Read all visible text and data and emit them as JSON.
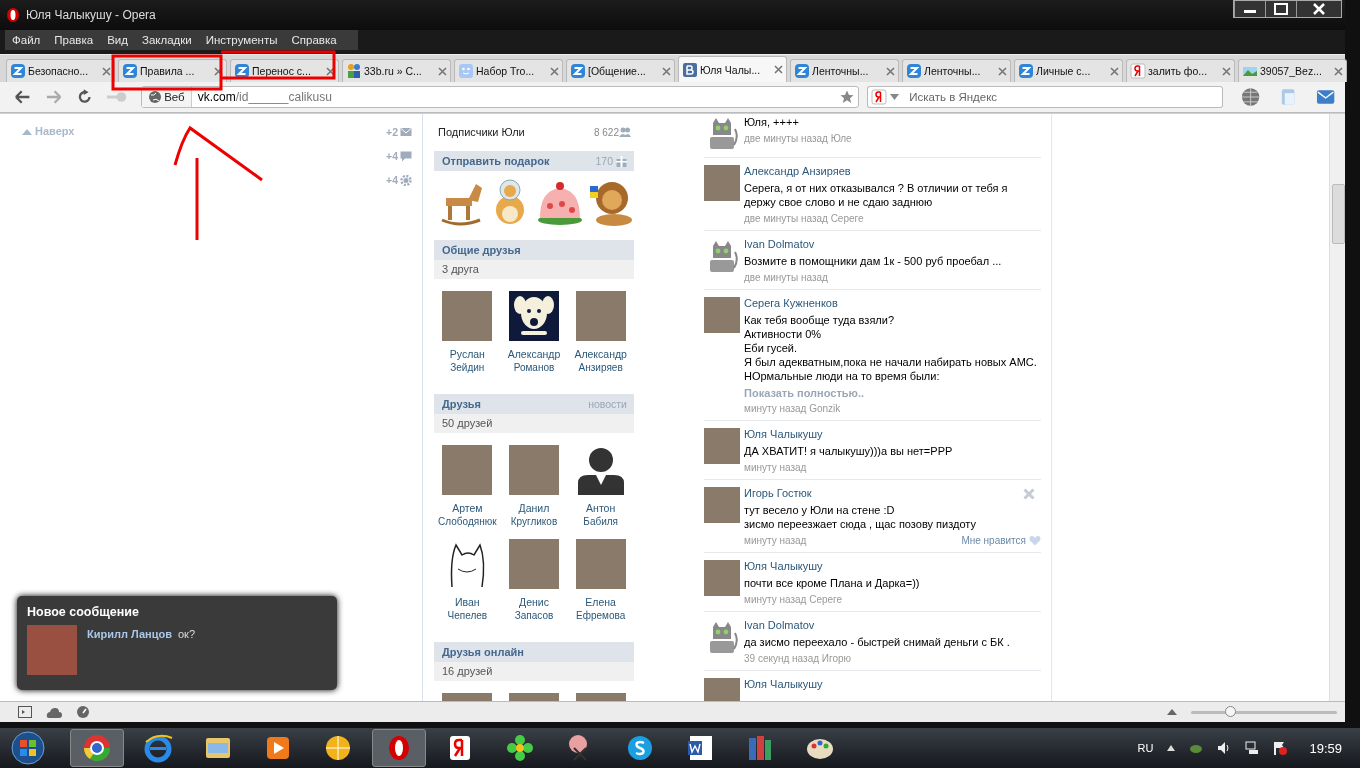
{
  "window": {
    "title": "Юля Чалыкушу - Opera"
  },
  "menu": [
    "Файл",
    "Правка",
    "Вид",
    "Закладки",
    "Инструменты",
    "Справка"
  ],
  "tabs": [
    {
      "label": "Безопасно...",
      "kind": "z",
      "selected": false
    },
    {
      "label": "Правила ...",
      "kind": "z",
      "selected": false
    },
    {
      "label": "Перенос с...",
      "kind": "z",
      "selected": false
    },
    {
      "label": "33b.ru » С...",
      "kind": "people",
      "selected": false
    },
    {
      "label": "Набор Tro...",
      "kind": "face",
      "selected": false
    },
    {
      "label": "[Общение...",
      "kind": "z",
      "selected": false
    },
    {
      "label": "Юля Чалы...",
      "kind": "vk",
      "selected": true
    },
    {
      "label": "Ленточны...",
      "kind": "z",
      "selected": false
    },
    {
      "label": "Ленточны...",
      "kind": "z",
      "selected": false
    },
    {
      "label": "Личные с...",
      "kind": "z",
      "selected": false
    },
    {
      "label": "залить фо...",
      "kind": "yandex",
      "selected": false
    },
    {
      "label": "39057_Bez...",
      "kind": "image",
      "selected": false
    }
  ],
  "address": {
    "mode": "Веб",
    "host": "vk.com",
    "path": "/id______calikusu"
  },
  "search": {
    "placeholder": "Искать в Яндекс"
  },
  "left": {
    "back_to_top": "Наверх",
    "counters": [
      {
        "count": "+2",
        "kind": "mail"
      },
      {
        "count": "+4",
        "kind": "chat"
      },
      {
        "count": "+4",
        "kind": "gear"
      }
    ]
  },
  "subscribers": {
    "label": "Подписчики Юли",
    "count": "8 622"
  },
  "gifts": {
    "title": "Отправить подарок",
    "count": "170"
  },
  "mutual_friends": {
    "title": "Общие друзья",
    "count": "3 друга",
    "friends": [
      {
        "first": "Руслан",
        "last": "Зейдин",
        "kind": "photo"
      },
      {
        "first": "Александр",
        "last": "Романов",
        "kind": "dog"
      },
      {
        "first": "Александр",
        "last": "Анзиряев",
        "kind": "photo"
      }
    ]
  },
  "friends": {
    "title": "Друзья",
    "link": "новости",
    "count": "50 друзей",
    "friends": [
      {
        "first": "Артем",
        "last": "Слободянюк",
        "kind": "photo"
      },
      {
        "first": "Данил",
        "last": "Кругликов",
        "kind": "photo"
      },
      {
        "first": "Антон",
        "last": "Бабиля",
        "kind": "silhouette"
      },
      {
        "first": "Иван",
        "last": "Чепелев",
        "kind": "sketch"
      },
      {
        "first": "Денис",
        "last": "Запасов",
        "kind": "photo"
      },
      {
        "first": "Елена",
        "last": "Ефремова",
        "kind": "photo"
      }
    ]
  },
  "online_friends": {
    "title": "Друзья онлайн",
    "count": "16 друзей"
  },
  "feed": [
    {
      "kind": "cat",
      "text": "Юля, ++++",
      "meta": "две минуты назад Юле"
    },
    {
      "kind": "photo",
      "author": "Александр Анзиряев",
      "text": "Серега, я от них отказывался ? В отличии от тебя я держу свое слово и не сдаю заднюю",
      "meta": "две минуты назад Сереге"
    },
    {
      "kind": "cat",
      "author": "Ivan Dolmatov",
      "text": "Возмите в помощники дам 1к - 500 руб проебал ...",
      "meta": "две минуты назад"
    },
    {
      "kind": "photo",
      "author": "Серега Кужненков",
      "text": "Как тебя вообще туда взяли?\nАктивности 0%\nЕби гусей.\nЯ был адекватным,пока не начали набирать новых АМС.\nНОрмальные люди на то время были:",
      "show_more": "Показать полностью..",
      "meta": "минуту назад Gonzik"
    },
    {
      "kind": "photo",
      "author": "Юля Чалыкушу",
      "text": "ДА ХВАТИТ! я чалыкушу)))а вы нет=PPP",
      "meta": "минуту назад"
    },
    {
      "kind": "photo",
      "author": "Игорь Гостюк",
      "text": "тут весело у Юли на стене :D\nзисмо переезжает сюда , щас позову пиздоту",
      "meta": "минуту назад",
      "like": "Мне нравится",
      "hovered": true
    },
    {
      "kind": "photo",
      "author": "Юля Чалыкушу",
      "text": "почти все кроме Плана и Дарка=))",
      "meta": "минуту назад Сереге"
    },
    {
      "kind": "cat",
      "author": "Ivan Dolmatov",
      "text": "да зисмо переехало - быстрей снимай деньги с БК .",
      "meta": "39 секунд назад Игорю"
    },
    {
      "kind": "photo",
      "author": "Юля Чалыкушу"
    }
  ],
  "notification": {
    "title": "Новое сообщение",
    "sender": "Кирилл Ланцов",
    "text": "ок?"
  },
  "zoom": {
    "level": 0.27
  },
  "taskbar": {
    "language": "RU",
    "time": "19:59"
  }
}
